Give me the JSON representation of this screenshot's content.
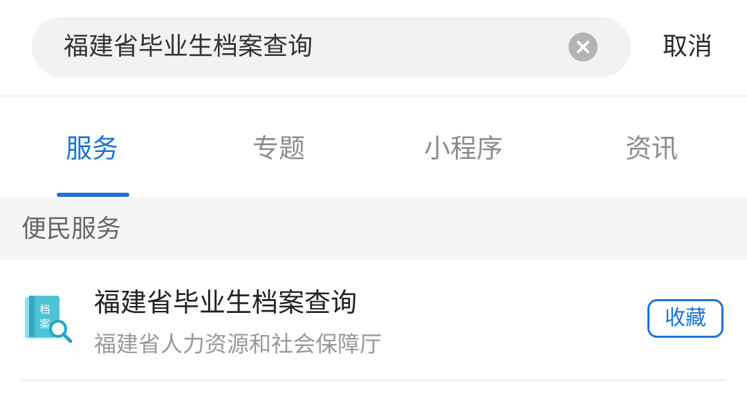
{
  "search": {
    "query": "福建省毕业生档案查询",
    "cancel_label": "取消"
  },
  "tabs": [
    {
      "label": "服务",
      "active": true
    },
    {
      "label": "专题",
      "active": false
    },
    {
      "label": "小程序",
      "active": false
    },
    {
      "label": "资讯",
      "active": false
    }
  ],
  "section": {
    "title": "便民服务"
  },
  "results": [
    {
      "title": "福建省毕业生档案查询",
      "subtitle": "福建省人力资源和社会保障厅",
      "icon": "archive-search-icon",
      "icon_text_top": "档",
      "icon_text_bottom": "案",
      "action_label": "收藏"
    }
  ],
  "colors": {
    "accent": "#1a73d6",
    "search_bg": "#f2f2f2",
    "section_bg": "#f5f5f5",
    "icon_teal": "#4fc3d6"
  }
}
